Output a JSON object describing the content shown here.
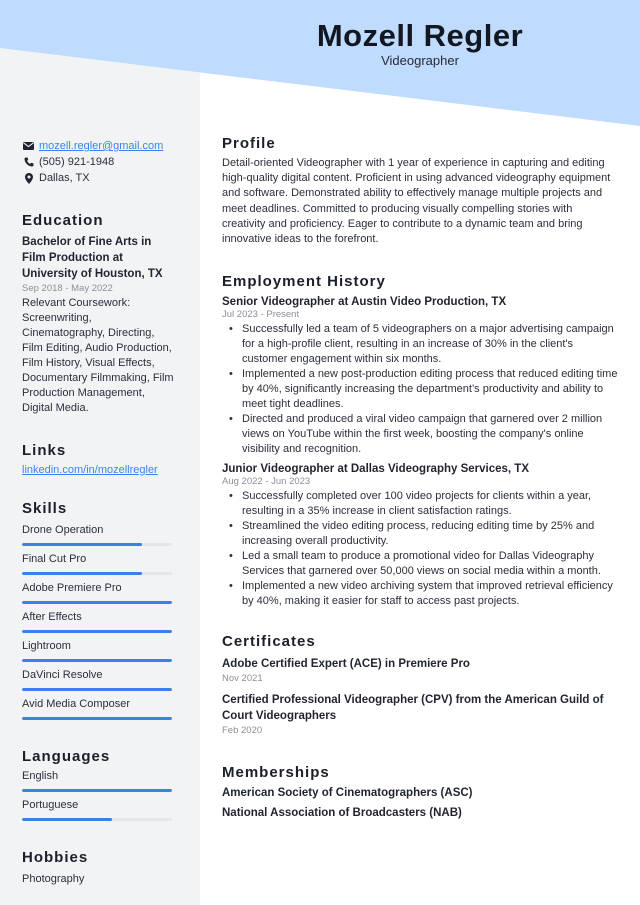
{
  "header": {
    "name": "Mozell Regler",
    "title": "Videographer",
    "banner_color": "#bfdbfe"
  },
  "contact": {
    "email": "mozell.regler@gmail.com",
    "phone": "(505) 921-1948",
    "location": "Dallas, TX",
    "icons": [
      "envelope-icon",
      "phone-icon",
      "map-pin-icon"
    ]
  },
  "education": {
    "heading": "Education",
    "degree": "Bachelor of Fine Arts in Film Production at University of Houston, TX",
    "dates": "Sep 2018 - May 2022",
    "description": "Relevant Coursework: Screenwriting, Cinematography, Directing, Film Editing, Audio Production, Film History, Visual Effects, Documentary Filmmaking, Film Production Management, Digital Media."
  },
  "links": {
    "heading": "Links",
    "items": [
      "linkedin.com/in/mozellregler"
    ]
  },
  "skills": {
    "heading": "Skills",
    "items": [
      {
        "label": "Drone Operation",
        "level": 0.8
      },
      {
        "label": "Final Cut Pro",
        "level": 0.8
      },
      {
        "label": "Adobe Premiere Pro",
        "level": 1.0
      },
      {
        "label": "After Effects",
        "level": 1.0
      },
      {
        "label": "Lightroom",
        "level": 1.0
      },
      {
        "label": "DaVinci Resolve",
        "level": 1.0
      },
      {
        "label": "Avid Media Composer",
        "level": 1.0
      }
    ]
  },
  "languages": {
    "heading": "Languages",
    "items": [
      {
        "label": "English",
        "level": 1.0
      },
      {
        "label": "Portuguese",
        "level": 0.6
      }
    ]
  },
  "hobbies": {
    "heading": "Hobbies",
    "items": [
      "Photography"
    ]
  },
  "profile": {
    "heading": "Profile",
    "text": "Detail-oriented Videographer with 1 year of experience in capturing and editing high-quality digital content. Proficient in using advanced videography equipment and software. Demonstrated ability to effectively manage multiple projects and meet deadlines. Committed to producing visually compelling stories with creativity and proficiency. Eager to contribute to a dynamic team and bring innovative ideas to the forefront."
  },
  "employment": {
    "heading": "Employment History",
    "jobs": [
      {
        "title": "Senior Videographer at Austin Video Production, TX",
        "dates": "Jul 2023 - Present",
        "bullets": [
          "Successfully led a team of 5 videographers on a major advertising campaign for a high-profile client, resulting in an increase of 30% in the client's customer engagement within six months.",
          "Implemented a new post-production editing process that reduced editing time by 40%, significantly increasing the department’s productivity and ability to meet tight deadlines.",
          "Directed and produced a viral video campaign that garnered over 2 million views on YouTube within the first week, boosting the company's online visibility and recognition."
        ]
      },
      {
        "title": "Junior Videographer at Dallas Videography Services, TX",
        "dates": "Aug 2022 - Jun 2023",
        "bullets": [
          "Successfully completed over 100 video projects for clients within a year, resulting in a 35% increase in client satisfaction ratings.",
          "Streamlined the video editing process, reducing editing time by 25% and increasing overall productivity.",
          "Led a small team to produce a promotional video for Dallas Videography Services that garnered over 50,000 views on social media within a month.",
          "Implemented a new video archiving system that improved retrieval efficiency by 40%, making it easier for staff to access past projects."
        ]
      }
    ]
  },
  "certificates": {
    "heading": "Certificates",
    "items": [
      {
        "title": "Adobe Certified Expert (ACE) in Premiere Pro",
        "date": "Nov 2021"
      },
      {
        "title": "Certified Professional Videographer (CPV) from the American Guild of Court Videographers",
        "date": "Feb 2020"
      }
    ]
  },
  "memberships": {
    "heading": "Memberships",
    "items": [
      "American Society of Cinematographers (ASC)",
      "National Association of Broadcasters (NAB)"
    ]
  },
  "colors": {
    "accent": "#3b7fe8",
    "link": "#3b82f6",
    "sidebar_bg": "#f2f3f5",
    "banner": "#bfdbfe"
  }
}
